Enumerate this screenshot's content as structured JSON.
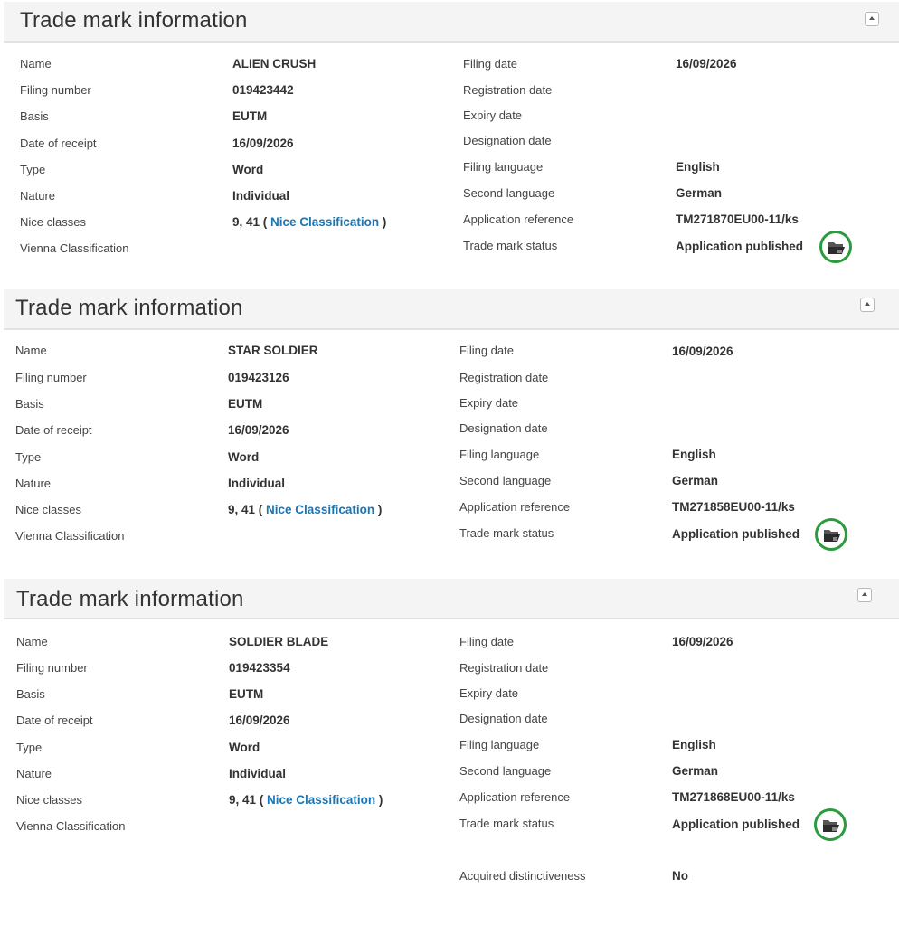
{
  "records": [
    {
      "title": "Trade mark information",
      "labels": {
        "name": "Name",
        "filing_number": "Filing number",
        "basis": "Basis",
        "date_of_receipt": "Date of receipt",
        "type": "Type",
        "nature": "Nature",
        "nice_classes": "Nice classes",
        "vienna": "Vienna Classification",
        "filing_date": "Filing date",
        "registration_date": "Registration date",
        "expiry_date": "Expiry date",
        "designation_date": "Designation date",
        "filing_language": "Filing language",
        "second_language": "Second language",
        "application_reference": "Application reference",
        "status": "Trade mark status"
      },
      "values": {
        "name": "ALIEN CRUSH",
        "filing_number": "019423442",
        "basis": "EUTM",
        "date_of_receipt": "16/09/2026",
        "type": "Word",
        "nature": "Individual",
        "nice_classes": "9, 41",
        "nice_open": " ( ",
        "nice_link": "Nice Classification",
        "nice_close": " )",
        "filing_date": "16/09/2026",
        "filing_language": "English",
        "second_language": "German",
        "application_reference": "TM271870EU00-11/ks",
        "status": "Application published"
      },
      "status_icon": "open-folder-icon"
    },
    {
      "title": "Trade mark information",
      "labels": {
        "name": "Name",
        "filing_number": "Filing number",
        "basis": "Basis",
        "date_of_receipt": "Date of receipt",
        "type": "Type",
        "nature": "Nature",
        "nice_classes": "Nice classes",
        "vienna": "Vienna Classification",
        "filing_date": "Filing date",
        "registration_date": "Registration date",
        "expiry_date": "Expiry date",
        "designation_date": "Designation date",
        "filing_language": "Filing language",
        "second_language": "Second language",
        "application_reference": "Application reference",
        "status": "Trade mark status"
      },
      "values": {
        "name": "STAR SOLDIER",
        "filing_number": "019423126",
        "basis": "EUTM",
        "date_of_receipt": "16/09/2026",
        "type": "Word",
        "nature": "Individual",
        "nice_classes": "9, 41",
        "nice_open": " ( ",
        "nice_link": "Nice Classification",
        "nice_close": " )",
        "filing_date": "16/09/2026",
        "filing_language": "English",
        "second_language": "German",
        "application_reference": "TM271858EU00-11/ks",
        "status": "Application published"
      },
      "status_icon": "open-folder-icon"
    },
    {
      "title": "Trade mark information",
      "labels": {
        "name": "Name",
        "filing_number": "Filing number",
        "basis": "Basis",
        "date_of_receipt": "Date of receipt",
        "type": "Type",
        "nature": "Nature",
        "nice_classes": "Nice classes",
        "vienna": "Vienna Classification",
        "filing_date": "Filing date",
        "registration_date": "Registration date",
        "expiry_date": "Expiry date",
        "designation_date": "Designation date",
        "filing_language": "Filing language",
        "second_language": "Second language",
        "application_reference": "Application reference",
        "status": "Trade mark status",
        "acquired_distinctiveness": "Acquired distinctiveness"
      },
      "values": {
        "name": "SOLDIER BLADE",
        "filing_number": "019423354",
        "basis": "EUTM",
        "date_of_receipt": "16/09/2026",
        "type": "Word",
        "nature": "Individual",
        "nice_classes": "9, 41",
        "nice_open": " ( ",
        "nice_link": "Nice Classification",
        "nice_close": " )",
        "filing_date": "16/09/2026",
        "filing_language": "English",
        "second_language": "German",
        "application_reference": "TM271868EU00-11/ks",
        "status": "Application published",
        "acquired_distinctiveness": "No"
      },
      "status_icon": "open-folder-icon"
    }
  ]
}
